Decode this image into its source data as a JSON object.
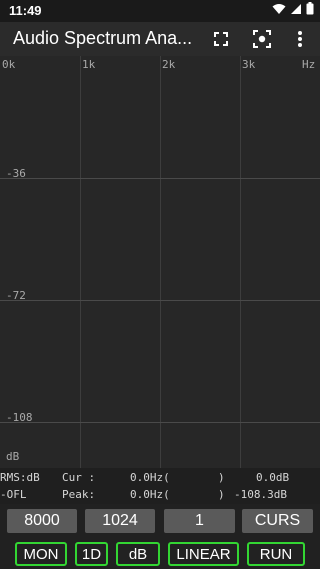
{
  "status_bar": {
    "time": "11:49",
    "icons": [
      "wifi-icon",
      "signal-icon",
      "battery-icon"
    ]
  },
  "app_bar": {
    "title": "Audio Spectrum Ana...",
    "actions": [
      "fullscreen-icon",
      "screenshot-icon",
      "more-vert-icon"
    ]
  },
  "spectrum": {
    "hz_labels": [
      "0k",
      "1k",
      "2k",
      "3k",
      "Hz"
    ],
    "db_labels": [
      "-36",
      "-72",
      "-108",
      "dB"
    ]
  },
  "info": {
    "rms_label": "RMS:dB",
    "cur_label": "Cur :",
    "cur_freq": "0.0Hz(",
    "cur_close": ")",
    "cur_value": "0.0dB",
    "ofl_label": "-OFL",
    "peak_label": "Peak:",
    "peak_freq": "0.0Hz(",
    "peak_close": ")",
    "peak_value": "-108.3dB"
  },
  "settings_buttons": {
    "sample_rate": "8000",
    "fft_length": "1024",
    "averages": "1",
    "cursor": "CURS"
  },
  "mode_buttons": {
    "monitor": "MON",
    "dimension": "1D",
    "unit": "dB",
    "scale": "LINEAR",
    "run": "RUN"
  },
  "colors": {
    "background": "#212121",
    "grid": "#4a4a4a",
    "accent_green": "#33d633",
    "button_gray": "#5a5a5a"
  }
}
